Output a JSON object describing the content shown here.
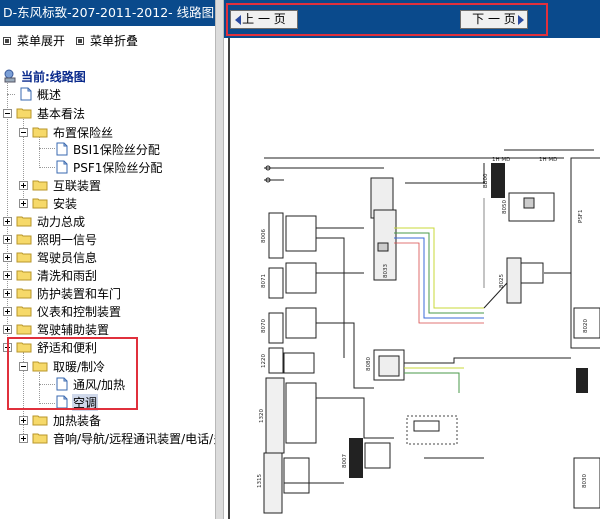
{
  "window": {
    "title": "D-东风标致-207-2011-2012- 线路图"
  },
  "menu": {
    "expand_label": "菜单展开",
    "collapse_label": "菜单折叠"
  },
  "tree": {
    "root": "当前:线路图",
    "overview": "概述",
    "basic": "基本看法",
    "fuse_layout": "布置保险丝",
    "bsi1": "BSI1保险丝分配",
    "psf1": "PSF1保险丝分配",
    "interconnect": "互联装置",
    "install": "安装",
    "powertrain": "动力总成",
    "lighting": "照明一信号",
    "driver_info": "驾驶员信息",
    "wash_wipe": "清洗和雨刮",
    "protection": "防护装置和车门",
    "instruments": "仪表和控制装置",
    "driving_aid": "驾驶辅助装置",
    "comfort": "舒适和便利",
    "heat_cool": "取暖/制冷",
    "ventilation": "通风/加热",
    "ac": "空调",
    "heater": "加热装备",
    "audio": "音响/导航/远程通讯装置/电话/多"
  },
  "nav": {
    "prev_label": "上 一 页",
    "next_label": "下 一 页"
  },
  "diagram": {
    "labels": [
      "1H MD",
      "1H MD",
      "BB00",
      "PSF1",
      "8050",
      "8033",
      "8025",
      "8006",
      "8071",
      "8070",
      "1220",
      "8080",
      "1320",
      "8020",
      "C001",
      "8007",
      "1315",
      "8030"
    ]
  },
  "colors": {
    "title_bg": "#0a4a8c",
    "highlight_red": "#e0303c",
    "folder_yellow": "#f6d96a"
  }
}
